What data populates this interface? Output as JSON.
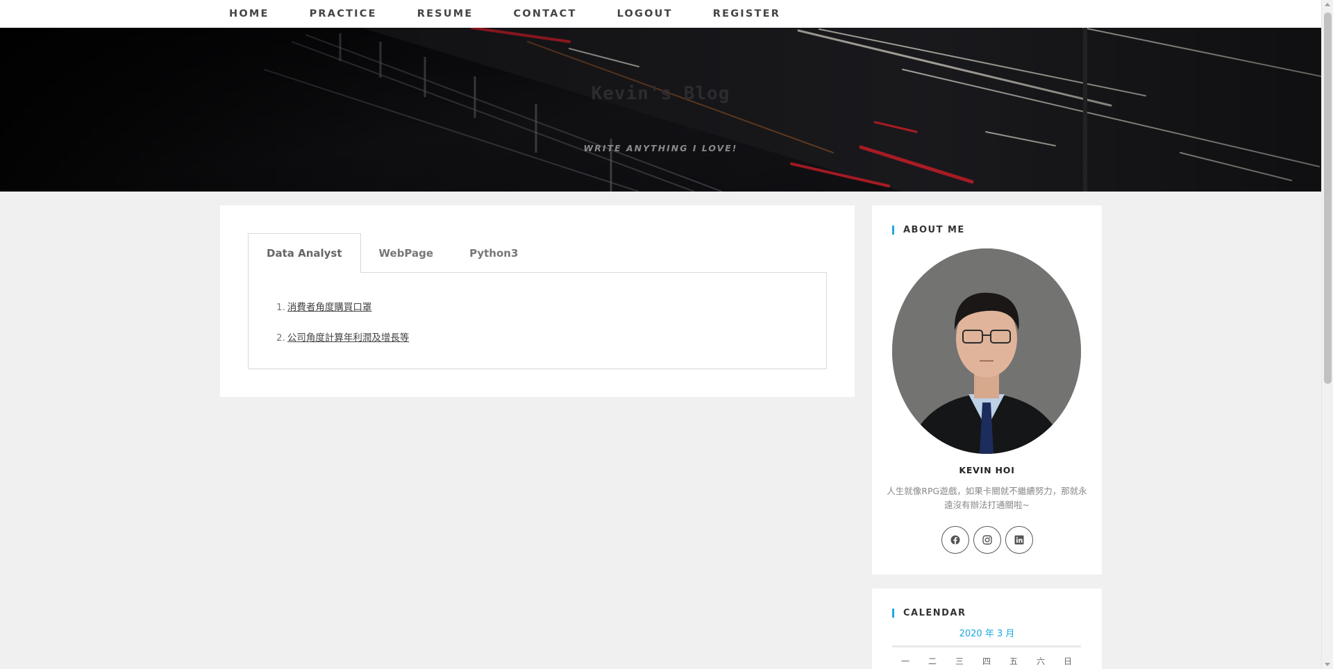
{
  "nav": {
    "items": [
      "HOME",
      "PRACTICE",
      "RESUME",
      "CONTACT",
      "LOGOUT",
      "REGISTER"
    ]
  },
  "hero": {
    "title": "Kevin's Blog",
    "tagline": "WRITE ANYTHING I LOVE!"
  },
  "main": {
    "tabs": [
      {
        "label": "Data Analyst",
        "active": true
      },
      {
        "label": "WebPage",
        "active": false
      },
      {
        "label": "Python3",
        "active": false
      }
    ],
    "items": [
      {
        "num": "1.",
        "label": "消費者角度購買口罩"
      },
      {
        "num": "2.",
        "label": "公司角度計算年利潤及增長等"
      }
    ]
  },
  "sidebar": {
    "about": {
      "title": "ABOUT ME",
      "name": "KEVIN HOI",
      "bio": "人生就像RPG遊戲，如果卡關就不繼續努力，那就永遠沒有辦法打通關啦~",
      "socials": [
        "facebook-icon",
        "instagram-icon",
        "linkedin-icon"
      ]
    },
    "calendar": {
      "title": "CALENDAR",
      "month": "2020 年 3 月",
      "weekdays": [
        "一",
        "二",
        "三",
        "四",
        "五",
        "六",
        "日"
      ]
    }
  },
  "colors": {
    "accent": "#1ca8e4",
    "background": "#f0f0f0",
    "card": "#ffffff"
  }
}
